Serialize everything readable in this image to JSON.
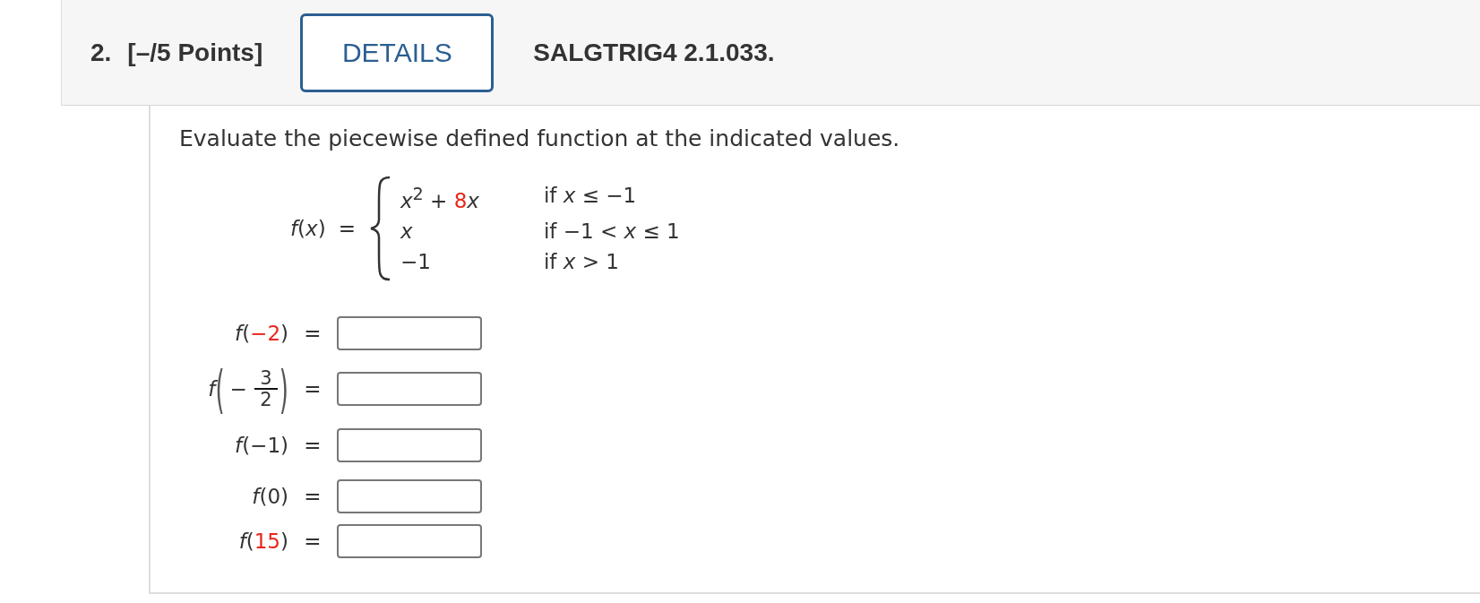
{
  "header": {
    "number": "2.",
    "points": "[–/5 Points]",
    "details_button": "DETAILS",
    "problem_code": "SALGTRIG4 2.1.033."
  },
  "prompt": "Evaluate the piecewise defined function at the indicated values.",
  "function": {
    "name": "*f*(*x*)",
    "equals": "=",
    "cases": [
      {
        "expression": [
          {
            "text": "*x*$^{2}$ + ",
            "color": "#333333"
          },
          {
            "text": "8",
            "color": "#e8261b"
          },
          {
            "text": "*x*",
            "color": "#333333"
          }
        ],
        "condition": "if *x* ≤ −1"
      },
      {
        "expression": [
          {
            "text": "*x*",
            "color": "#333333"
          }
        ],
        "condition": "if −1 < *x* ≤ 1"
      },
      {
        "expression": [
          {
            "text": "−1",
            "color": "#333333"
          }
        ],
        "condition": "if *x* > 1"
      }
    ]
  },
  "answers": [
    {
      "kind": "plain",
      "label": [
        {
          "text": "*f*(",
          "color": "#333333"
        },
        {
          "text": "−2",
          "color": "#e8261b"
        },
        {
          "text": ")",
          "color": "#333333"
        }
      ],
      "equals": "="
    },
    {
      "kind": "fraction",
      "name": "f",
      "open": "(",
      "sign": "−",
      "numerator": "3",
      "denominator": "2",
      "close": ")",
      "equals": "="
    },
    {
      "kind": "plain",
      "label": [
        {
          "text": "*f*(−1)",
          "color": "#333333"
        }
      ],
      "equals": "="
    },
    {
      "kind": "plain",
      "label": [
        {
          "text": "*f*(0)",
          "color": "#333333"
        }
      ],
      "equals": "="
    },
    {
      "kind": "plain",
      "label": [
        {
          "text": "*f*(",
          "color": "#333333"
        },
        {
          "text": "15",
          "color": "#e8261b"
        },
        {
          "text": ")",
          "color": "#333333"
        }
      ],
      "equals": "="
    }
  ]
}
